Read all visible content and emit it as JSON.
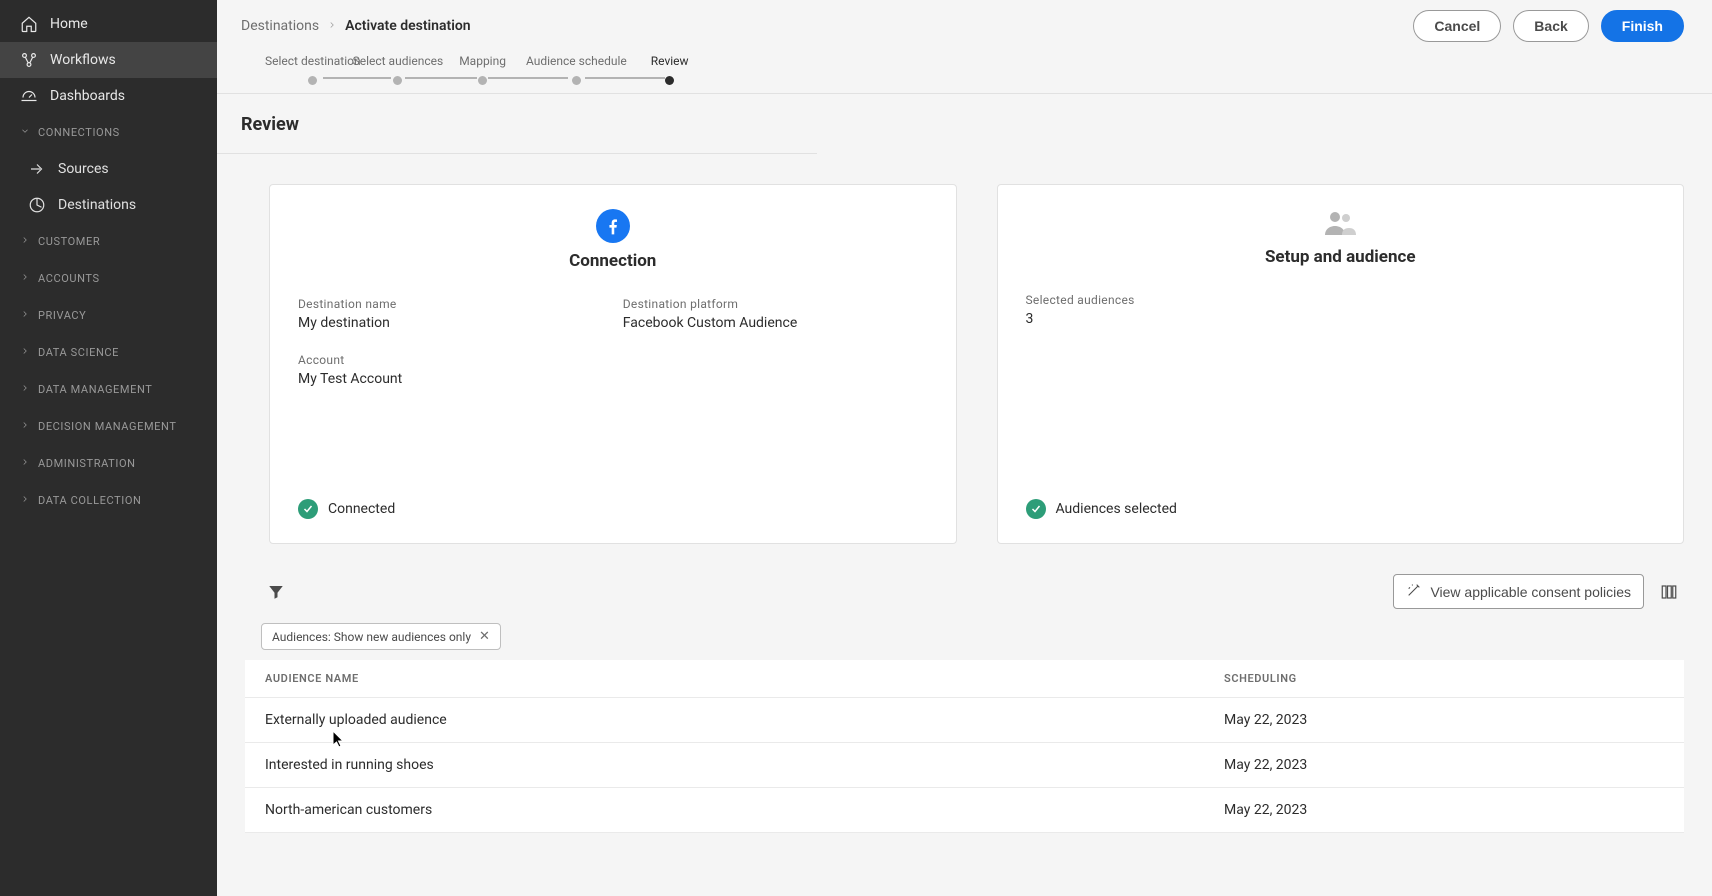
{
  "sidebar": {
    "home": "Home",
    "workflows": "Workflows",
    "dashboards": "Dashboards",
    "sections": {
      "connections": "CONNECTIONS",
      "customer": "CUSTOMER",
      "accounts": "ACCOUNTS",
      "privacy": "PRIVACY",
      "data_science": "DATA SCIENCE",
      "data_management": "DATA MANAGEMENT",
      "decision_management": "DECISION MANAGEMENT",
      "administration": "ADMINISTRATION",
      "data_collection": "DATA COLLECTION"
    },
    "connections_children": {
      "sources": "Sources",
      "destinations": "Destinations"
    }
  },
  "breadcrumb": {
    "root": "Destinations",
    "current": "Activate destination"
  },
  "buttons": {
    "cancel": "Cancel",
    "back": "Back",
    "finish": "Finish"
  },
  "stepper": {
    "s1": "Select destination",
    "s2": "Select audiences",
    "s3": "Mapping",
    "s4": "Audience schedule",
    "s5": "Review"
  },
  "section_title": "Review",
  "connection_card": {
    "title": "Connection",
    "dest_name_label": "Destination name",
    "dest_name_value": "My destination",
    "dest_platform_label": "Destination platform",
    "dest_platform_value": "Facebook Custom Audience",
    "account_label": "Account",
    "account_value": "My Test Account",
    "status": "Connected"
  },
  "setup_card": {
    "title": "Setup and audience",
    "selected_label": "Selected audiences",
    "selected_value": "3",
    "status": "Audiences selected"
  },
  "table": {
    "filter_chip": "Audiences: Show new audiences only",
    "consent_btn": "View applicable consent policies",
    "headers": {
      "name": "AUDIENCE NAME",
      "scheduling": "SCHEDULING"
    },
    "rows": [
      {
        "name": "Externally uploaded audience",
        "scheduling": "May 22, 2023"
      },
      {
        "name": "Interested in running shoes",
        "scheduling": "May 22, 2023"
      },
      {
        "name": "North-american customers",
        "scheduling": "May 22, 2023"
      }
    ]
  }
}
